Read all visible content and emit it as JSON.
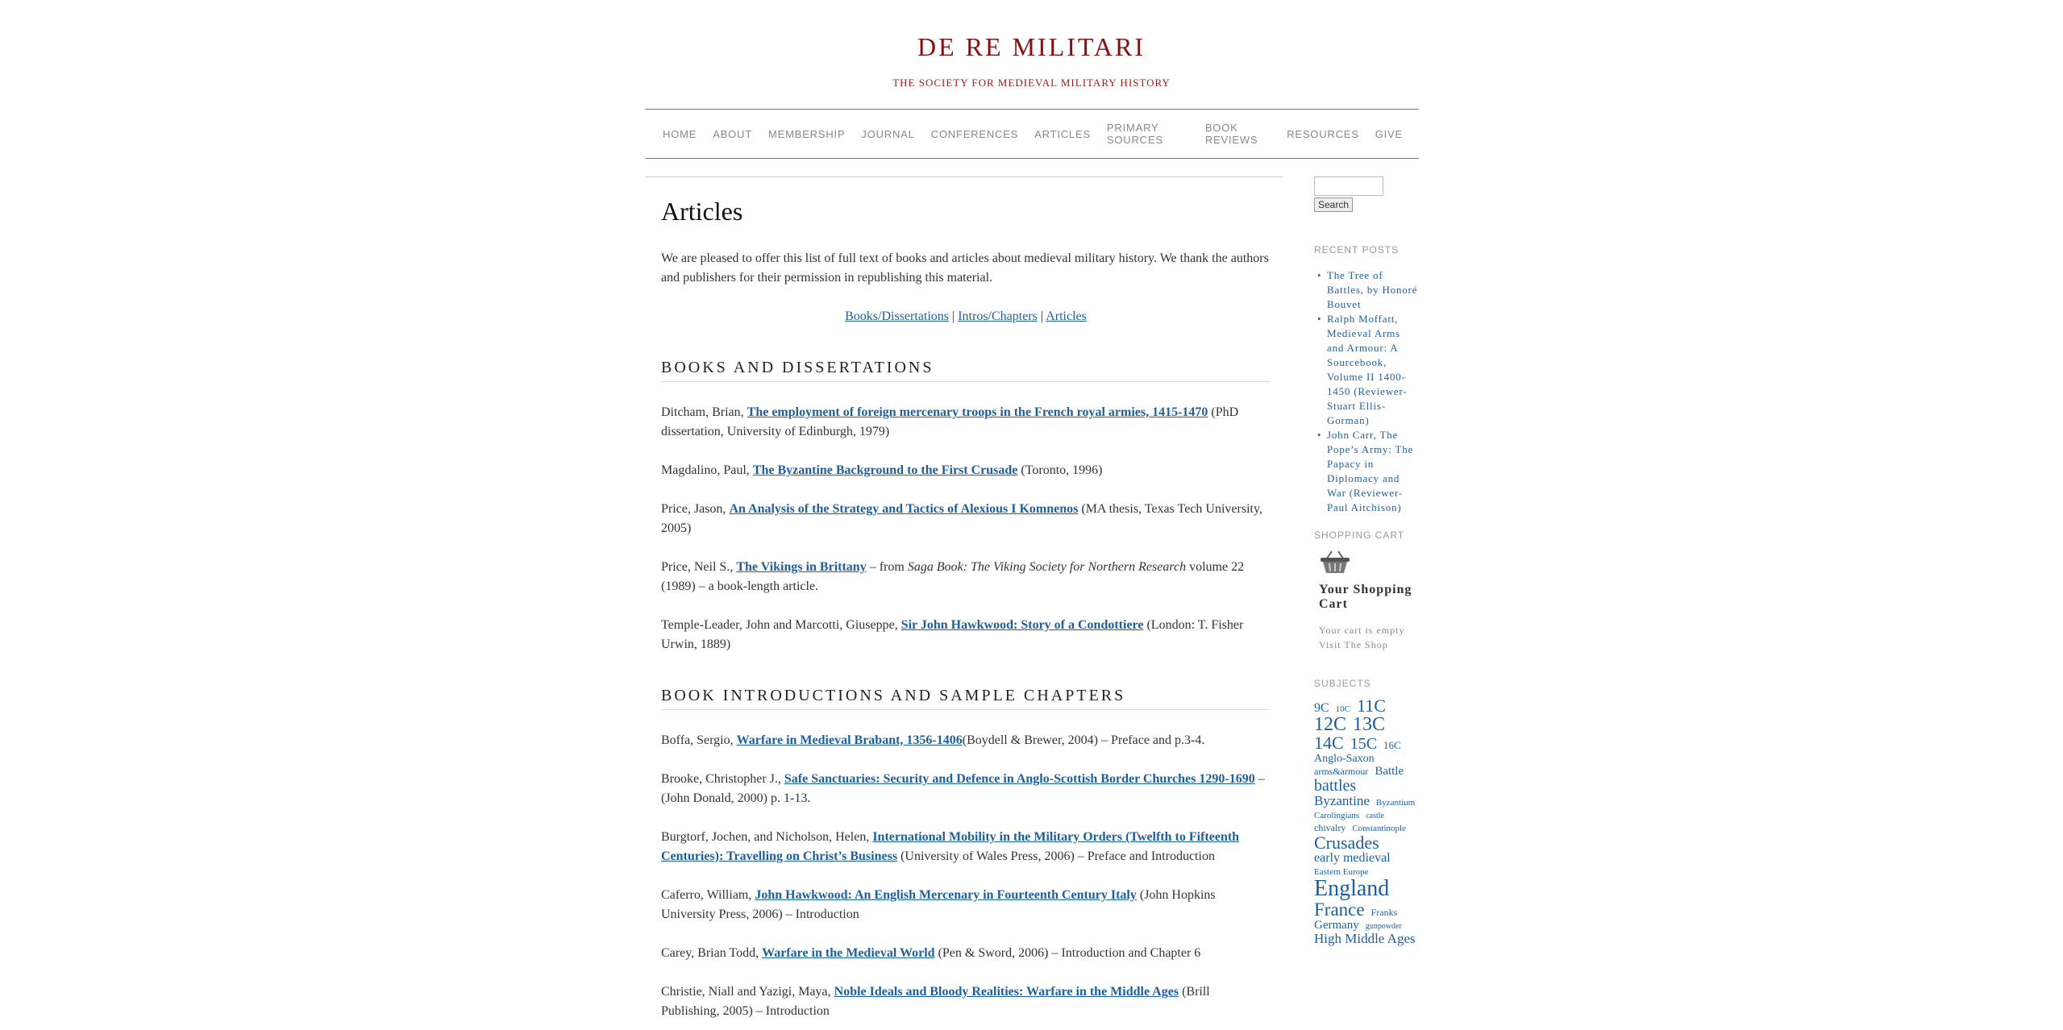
{
  "site": {
    "title": "DE RE MILITARI",
    "description": "THE SOCIETY FOR MEDIEVAL MILITARY HISTORY"
  },
  "nav": [
    "HOME",
    "ABOUT",
    "MEMBERSHIP",
    "JOURNAL",
    "CONFERENCES",
    "ARTICLES",
    "PRIMARY SOURCES",
    "BOOK REVIEWS",
    "RESOURCES",
    "GIVE"
  ],
  "page": {
    "title": "Articles",
    "intro": "We are pleased to offer this list of full text of books and articles about medieval military history.  We thank the authors and publishers for their permission in republishing this material.",
    "toc": {
      "books": "Books/Dissertations",
      "sep": " | ",
      "intros": "Intros/Chapters",
      "articles": "Articles"
    }
  },
  "sections": [
    {
      "heading": "BOOKS AND DISSERTATIONS",
      "entries": [
        {
          "pre": "Ditcham, Brian, ",
          "link": "The employment of foreign mercenary troops in the French royal armies, 1415-1470",
          "post": " (PhD dissertation, University of Edinburgh, 1979)"
        },
        {
          "pre": "Magdalino, Paul, ",
          "link": "The Byzantine Background to the First Crusade",
          "post": " (Toronto, 1996)"
        },
        {
          "pre": "Price, Jason, ",
          "link": "An Analysis of the Strategy and Tactics of Alexious I Komnenos",
          "post": " (MA thesis, Texas Tech University, 2005)"
        },
        {
          "pre": "Price, Neil S., ",
          "link": "The Vikings in Brittany",
          "post": " – from ",
          "ital": "Saga Book: The Viking Society for Northern Research",
          "post2": " volume 22 (1989) – a book-length article."
        },
        {
          "pre": "Temple-Leader, John and Marcotti, Giuseppe, ",
          "link": "Sir John Hawkwood: Story of a Condottiere",
          "post": " (London: T. Fisher Urwin, 1889)"
        }
      ]
    },
    {
      "heading": "BOOK INTRODUCTIONS AND SAMPLE CHAPTERS",
      "entries": [
        {
          "pre": "Boffa, Sergio, ",
          "link": "Warfare in Medieval Brabant, 1356-1406",
          "post": "(Boydell & Brewer, 2004) – Preface and p.3-4."
        },
        {
          "pre": "Brooke, Christopher J., ",
          "link": "Safe Sanctuaries: Security and Defence in Anglo-Scottish Border Churches 1290-1690",
          "post": " – (John Donald, 2000) p. 1-13."
        },
        {
          "pre": "Burgtorf, Jochen, and Nicholson, Helen, ",
          "link": "International Mobility in the Military Orders (Twelfth to Fifteenth Centuries): Travelling on Christ’s Business",
          "post": " (University of Wales Press, 2006) – Preface and Introduction"
        },
        {
          "pre": "Caferro, William, ",
          "link": "John Hawkwood: An English Mercenary in Fourteenth Century Italy",
          "post": " (John Hopkins University Press, 2006) – Introduction"
        },
        {
          "pre": "Carey, Brian Todd, ",
          "link": "Warfare in the Medieval World",
          "post": " (Pen & Sword, 2006) – Introduction and Chapter 6"
        },
        {
          "pre": "Christie, Niall and Yazigi, Maya, ",
          "link": "Noble Ideals and Bloody Realities: Warfare in the Middle Ages",
          "post": " (Brill Publishing, 2005) – Introduction"
        }
      ]
    }
  ],
  "sidebar": {
    "search_button": "Search",
    "recent_title": "RECENT POSTS",
    "recent": [
      "The Tree of Battles, by Honoré Bouvet",
      "Ralph Moffatt, Medieval Arms and Armour: A Sourcebook, Volume II 1400-1450 (Reviewer-Stuart Ellis-Gorman)",
      "John Carr, The Pope’s Army: The Papacy in Diplomacy and War (Reviewer-Paul Aitchison)"
    ],
    "cart_title_label": "SHOPPING CART",
    "cart_heading": "Your Shopping Cart",
    "cart_empty": "Your cart is empty",
    "cart_visit": "Visit The Shop",
    "subjects_title": "SUBJECTS",
    "tags": [
      {
        "t": "9C",
        "s": 16
      },
      {
        "t": "10C",
        "s": 11
      },
      {
        "t": "11C",
        "s": 22
      },
      {
        "t": "12C",
        "s": 24
      },
      {
        "t": "13C",
        "s": 24
      },
      {
        "t": "14C",
        "s": 22
      },
      {
        "t": "15C",
        "s": 20
      },
      {
        "t": "16C",
        "s": 13
      },
      {
        "t": "Anglo-Saxon",
        "s": 14
      },
      {
        "t": "arms&armour",
        "s": 12
      },
      {
        "t": "Battle",
        "s": 15
      },
      {
        "t": "battles",
        "s": 20
      },
      {
        "t": "Byzantine",
        "s": 17
      },
      {
        "t": "Byzantium",
        "s": 11
      },
      {
        "t": "Carolingians",
        "s": 11
      },
      {
        "t": "castle",
        "s": 10
      },
      {
        "t": "chivalry",
        "s": 12
      },
      {
        "t": "Constantinople",
        "s": 11
      },
      {
        "t": "Crusades",
        "s": 22
      },
      {
        "t": "early medieval",
        "s": 16
      },
      {
        "t": "Eastern Europe",
        "s": 11
      },
      {
        "t": "England",
        "s": 28
      },
      {
        "t": "France",
        "s": 23
      },
      {
        "t": "Franks",
        "s": 12
      },
      {
        "t": "Germany",
        "s": 15
      },
      {
        "t": "gunpowder",
        "s": 10
      },
      {
        "t": "High Middle Ages",
        "s": 17
      }
    ]
  },
  "colors": {
    "title": "#8a0e0e",
    "link": "#1d5f9c",
    "nav": "#888888"
  }
}
